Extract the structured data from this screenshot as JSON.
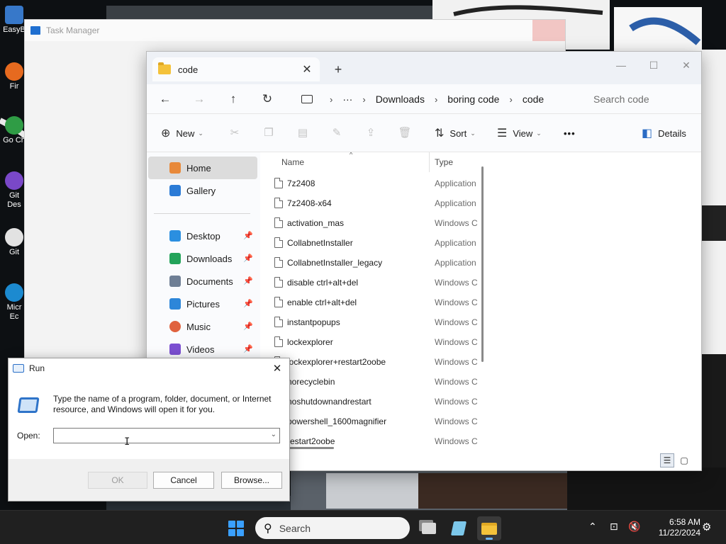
{
  "desktop": {
    "icons": [
      {
        "label": "EasyB"
      },
      {
        "label": "Fir"
      },
      {
        "label": "Go Ch"
      },
      {
        "label": "Git Des"
      },
      {
        "label": "Git"
      },
      {
        "label": "Micr Ec"
      }
    ]
  },
  "taskmgr": {
    "title": "Task Manager"
  },
  "explorer": {
    "tab_label": "code",
    "new_tab": "+",
    "window": {
      "minimize": "—",
      "maximize": "☐",
      "close": "✕"
    },
    "breadcrumb": [
      "Downloads",
      "boring code",
      "code"
    ],
    "search_placeholder": "Search code",
    "commands": {
      "new": "New",
      "sort": "Sort",
      "view": "View",
      "more": "•••",
      "details": "Details"
    },
    "sidebar": {
      "top": [
        {
          "label": "Home",
          "icon": "home-icon",
          "color": "#e8893a",
          "selected": true
        },
        {
          "label": "Gallery",
          "icon": "gallery-icon",
          "color": "#2b7bd6"
        }
      ],
      "pinned": [
        {
          "label": "Desktop",
          "icon": "desktop-icon",
          "color": "#2b8fe0"
        },
        {
          "label": "Downloads",
          "icon": "download-icon",
          "color": "#23a35a"
        },
        {
          "label": "Documents",
          "icon": "documents-icon",
          "color": "#6f7f95"
        },
        {
          "label": "Pictures",
          "icon": "pictures-icon",
          "color": "#2d86d9"
        },
        {
          "label": "Music",
          "icon": "music-icon",
          "color": "#e0623e"
        },
        {
          "label": "Videos",
          "icon": "videos-icon",
          "color": "#7b4fd1"
        }
      ]
    },
    "columns": {
      "name": "Name",
      "type": "Type"
    },
    "files": [
      {
        "name": "7z2408",
        "type": "Application"
      },
      {
        "name": "7z2408-x64",
        "type": "Application"
      },
      {
        "name": "activation_mas",
        "type": "Windows C"
      },
      {
        "name": "CollabnetInstaller",
        "type": "Application"
      },
      {
        "name": "CollabnetInstaller_legacy",
        "type": "Application"
      },
      {
        "name": "disable ctrl+alt+del",
        "type": "Windows C"
      },
      {
        "name": "enable ctrl+alt+del",
        "type": "Windows C"
      },
      {
        "name": "instantpopups",
        "type": "Windows C"
      },
      {
        "name": "lockexplorer",
        "type": "Windows C"
      },
      {
        "name": "lockexplorer+restart2oobe",
        "type": "Windows C"
      },
      {
        "name": "norecyclebin",
        "type": "Windows C"
      },
      {
        "name": "noshutdownandrestart",
        "type": "Windows C"
      },
      {
        "name": "powershell_1600magnifier",
        "type": "Windows C"
      },
      {
        "name": "restart2oobe",
        "type": "Windows C"
      }
    ]
  },
  "run": {
    "title": "Run",
    "close": "✕",
    "description": "Type the name of a program, folder, document, or Internet resource, and Windows will open it for you.",
    "open_label": "Open:",
    "open_value": "",
    "buttons": {
      "ok": "OK",
      "cancel": "Cancel",
      "browse": "Browse..."
    }
  },
  "taskbar": {
    "search_placeholder": "Search",
    "time": "6:58 AM",
    "date": "11/22/2024",
    "accent": "#3aa0ff"
  }
}
